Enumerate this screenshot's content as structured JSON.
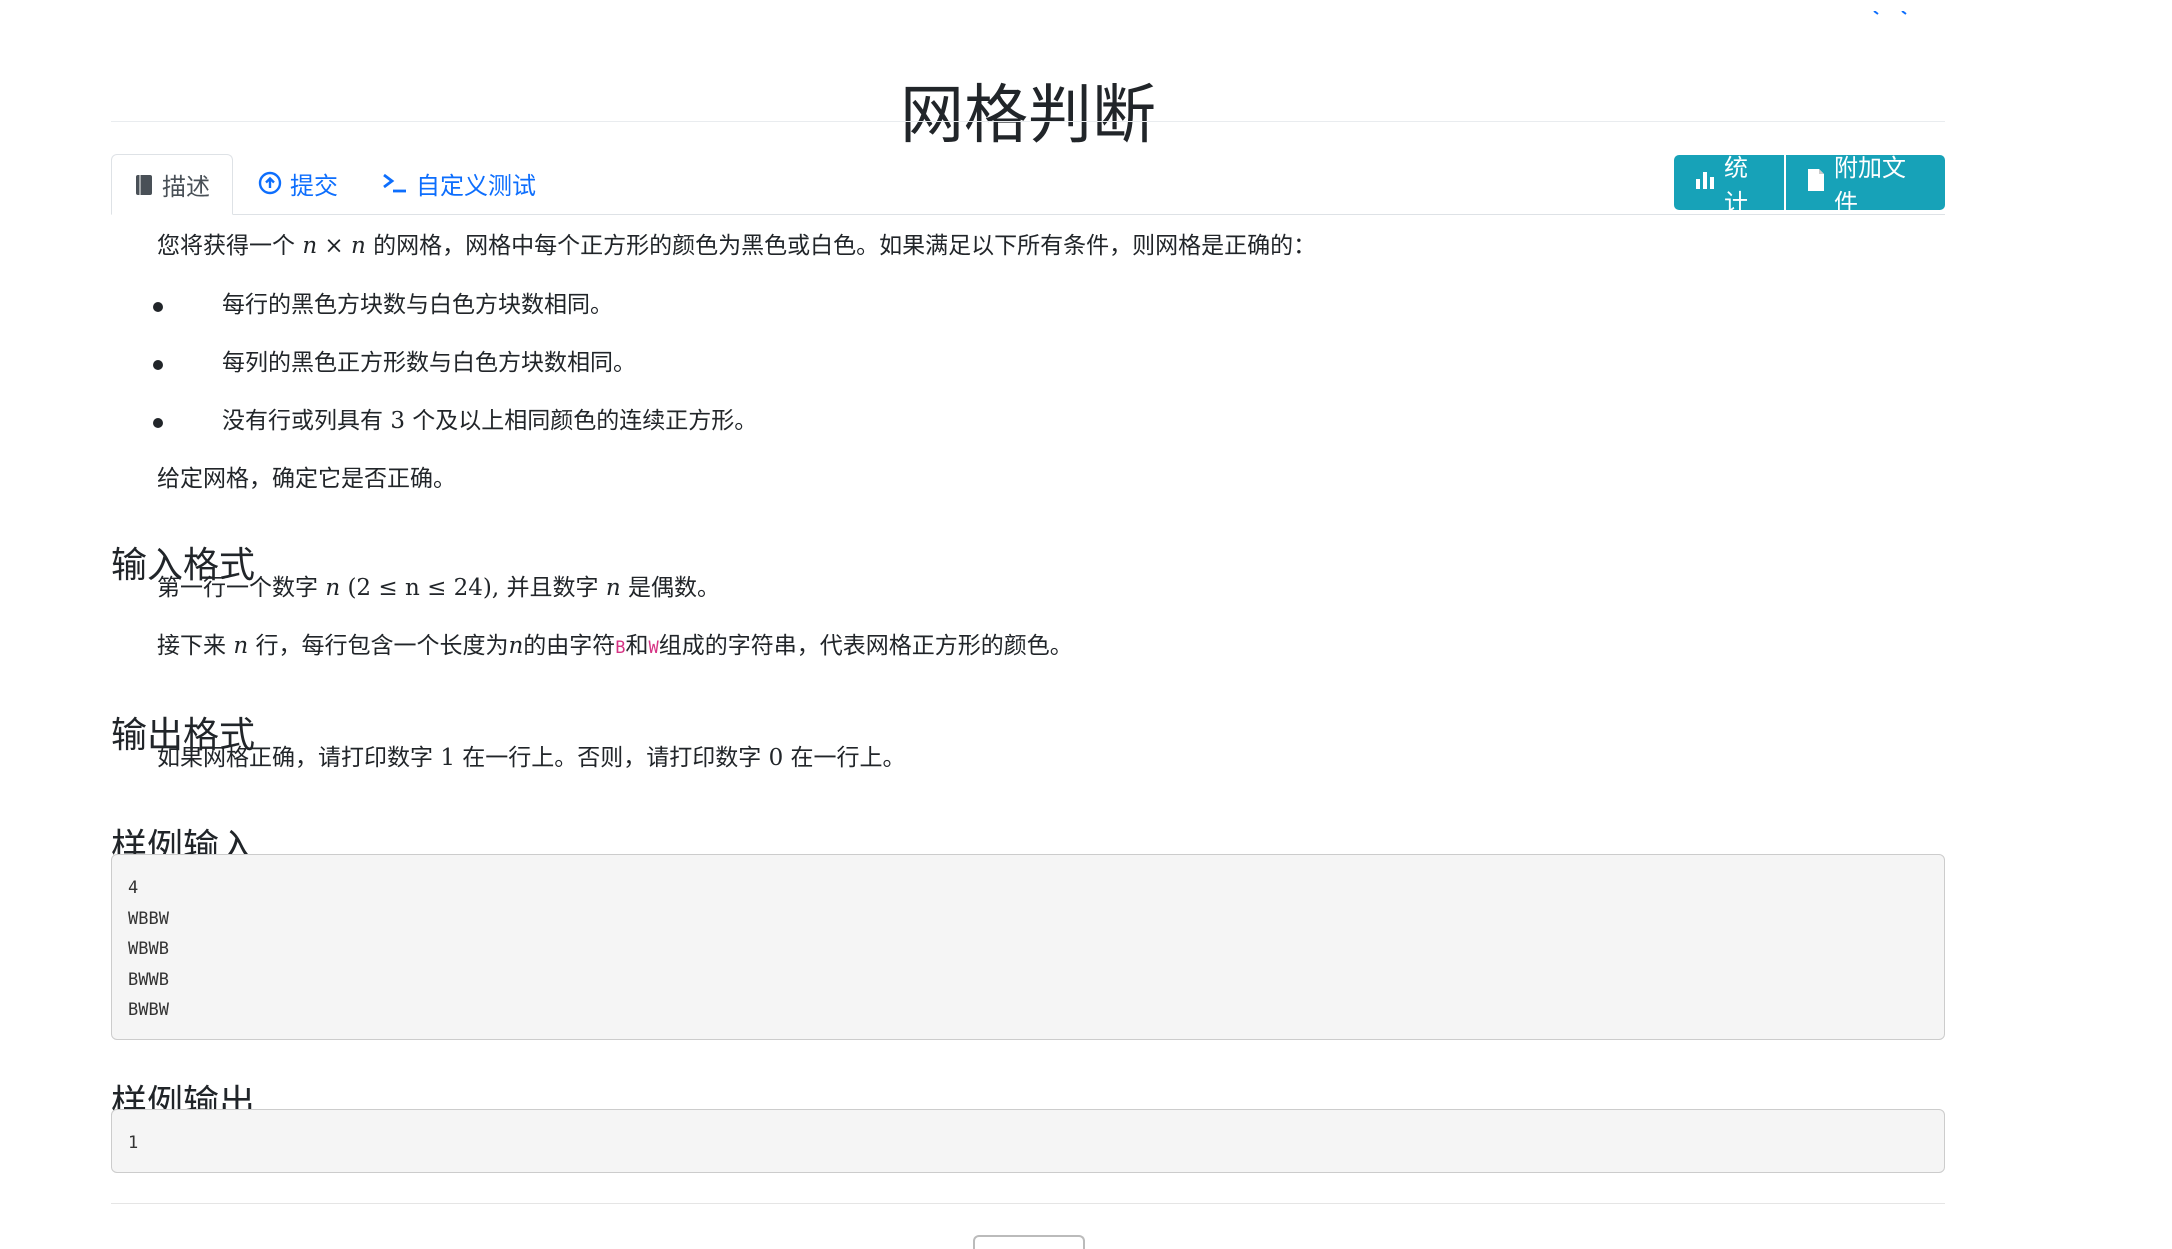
{
  "page": {
    "title": "网格判断"
  },
  "tabs": [
    {
      "label": "描述",
      "icon": "book-icon",
      "active": true
    },
    {
      "label": "提交",
      "icon": "upload-circle-icon",
      "active": false
    },
    {
      "label": "自定义测试",
      "icon": "terminal-icon",
      "active": false
    }
  ],
  "actions": {
    "stats_label": "统计",
    "stats_icon": "bar-chart-icon",
    "files_label": "附加文件",
    "files_icon": "file-icon",
    "color": "#17a2b8"
  },
  "description": {
    "intro_a": "您将获得一个",
    "intro_math": "n × n",
    "intro_b": "的网格，网格中每个正方形的颜色为黑色或白色。如果满足以下所有条件，则网格是正确的：",
    "bullets": [
      {
        "text": "每行的黑色方块数与白色方块数相同。"
      },
      {
        "text": "每列的黑色正方形数与白色方块数相同。"
      },
      {
        "text_a": "没有行或列具有",
        "math": "3",
        "text_b": "个及以上相同颜色的连续正方形。"
      }
    ],
    "closing": "给定网格，确定它是否正确。"
  },
  "input_format": {
    "heading": "输入格式",
    "line1_a": "第一行一个数字",
    "line1_var": "n",
    "line1_cond": "(2 ≤ n ≤ 24),",
    "line1_b": "并且数字",
    "line1_var2": "n",
    "line1_c": "是偶数。",
    "line2_a": "接下来",
    "line2_var": "n",
    "line2_b": "行，每行包含一个长度为",
    "line2_var2": "n",
    "line2_c": "的由字符",
    "char_b": "B",
    "line2_d": "和",
    "char_w": "W",
    "line2_e": "组成的字符串，代表网格正方形的颜色。"
  },
  "output_format": {
    "heading": "输出格式",
    "text_a": "如果网格正确，请打印数字",
    "one": "1",
    "text_b": "在一行上。否则，请打印数字",
    "zero": "0",
    "text_c": "在一行上。"
  },
  "sample_input": {
    "heading": "样例输入",
    "content": "4\nWBBW\nWBWB\nBWWB\nBWBW"
  },
  "sample_output": {
    "heading": "样例输出",
    "content": "1"
  }
}
